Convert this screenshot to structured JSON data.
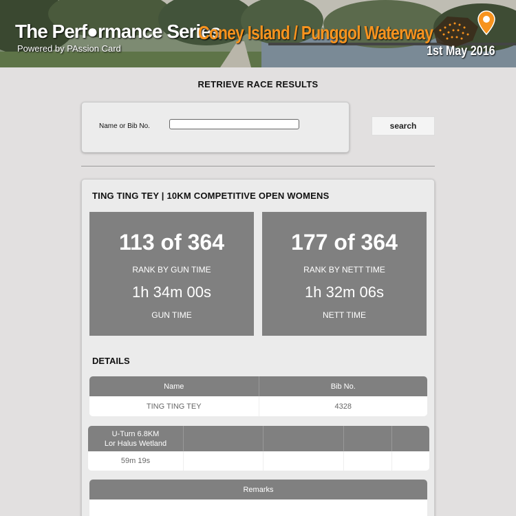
{
  "banner": {
    "series_title": "The Perf●rmance Series",
    "powered_by": "Powered by PAssion Card",
    "event_name": "Coney Island / Punggol Waterway",
    "event_date": "1st May 2016",
    "accent_color": "#f7931e"
  },
  "page": {
    "heading": "RETRIEVE RACE RESULTS"
  },
  "search": {
    "label": "Name or Bib No.",
    "value": "",
    "placeholder": "",
    "button_label": "search"
  },
  "result": {
    "title": "TING TING TEY | 10KM COMPETITIVE OPEN WOMENS",
    "gun": {
      "rank": "113 of 364",
      "rank_label": "RANK BY GUN TIME",
      "time": "1h 34m 00s",
      "time_label": "GUN TIME"
    },
    "nett": {
      "rank": "177 of 364",
      "rank_label": "RANK BY NETT TIME",
      "time": "1h 32m 06s",
      "time_label": "NETT TIME"
    },
    "details_heading": "DETAILS",
    "info_table": {
      "headers": [
        "Name",
        "Bib No."
      ],
      "row": [
        "TING TING TEY",
        "4328"
      ]
    },
    "split_table": {
      "header_line1": "U-Turn 6.8KM",
      "header_line2": "Lor Halus Wetland",
      "value": "59m 19s"
    },
    "remarks_table": {
      "header": "Remarks",
      "value": ""
    }
  }
}
